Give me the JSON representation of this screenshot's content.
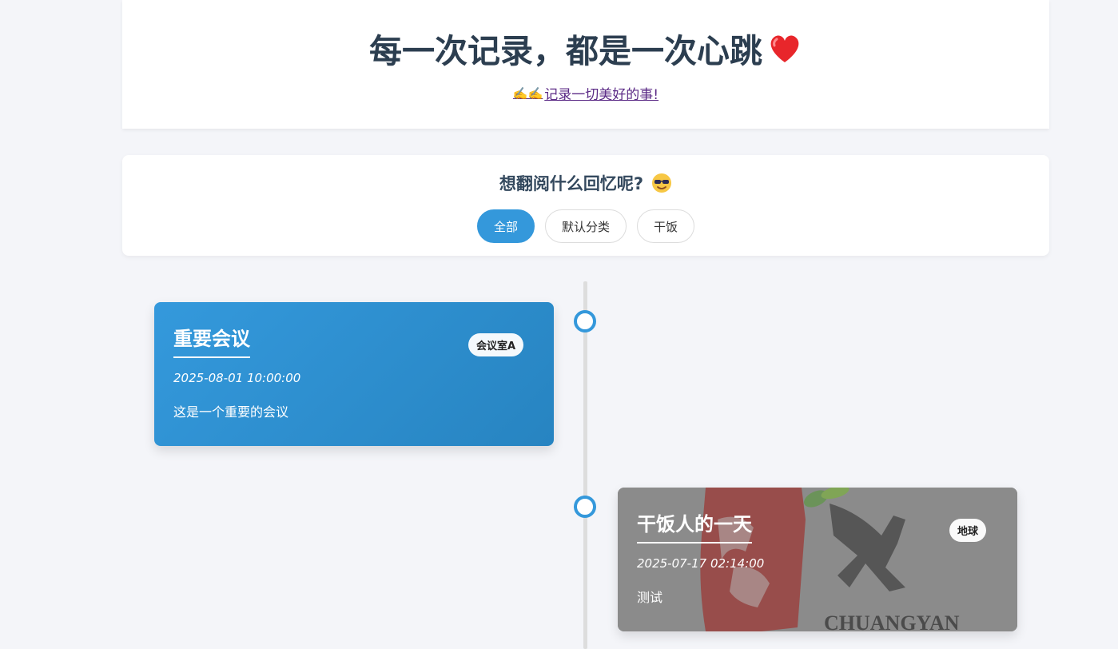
{
  "header": {
    "title": "每一次记录，都是一次心跳",
    "subtitle_emoji": "✍️✍️",
    "subtitle_text": "记录一切美好的事!"
  },
  "filter": {
    "title": "想翻阅什么回忆呢?",
    "options": [
      "全部",
      "默认分类",
      "干饭"
    ],
    "active": "全部"
  },
  "timeline": {
    "events": [
      {
        "title": "重要会议",
        "location": "会议室A",
        "datetime": "2025-08-01 10:00:00",
        "description": "这是一个重要的会议"
      },
      {
        "title": "干饭人的一天",
        "location": "地球",
        "datetime": "2025-07-17 02:14:00",
        "description": "测试",
        "background_logo_text": "CHUANGYAN"
      }
    ]
  },
  "colors": {
    "accent": "#3498db",
    "title": "#2c3e50",
    "background": "#f4f5f9"
  }
}
